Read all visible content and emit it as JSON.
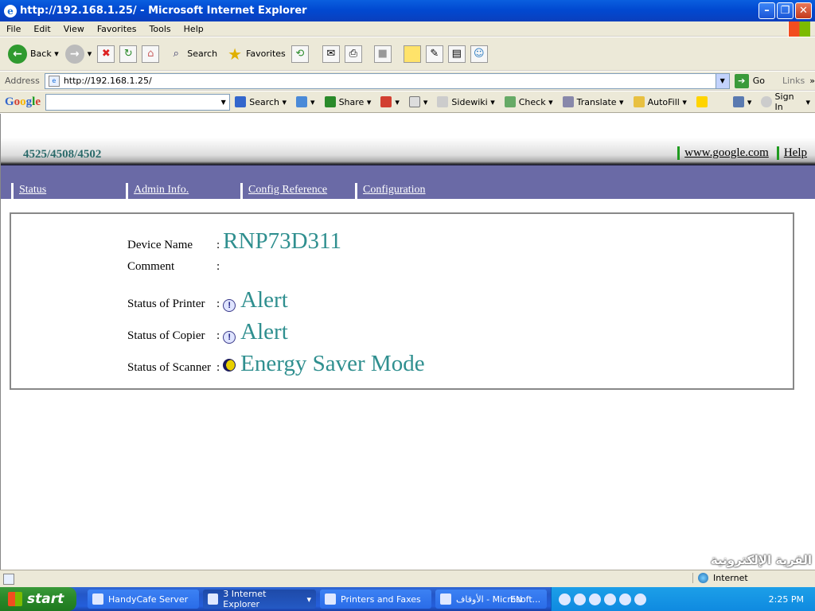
{
  "window": {
    "title": "http://192.168.1.25/ - Microsoft Internet Explorer",
    "icon": "ie-logo-icon"
  },
  "menu": [
    "File",
    "Edit",
    "View",
    "Favorites",
    "Tools",
    "Help"
  ],
  "toolbar": {
    "back": "Back",
    "search": "Search",
    "favorites": "Favorites"
  },
  "address": {
    "label": "Address",
    "url": "http://192.168.1.25/",
    "go": "Go",
    "links": "Links"
  },
  "google_toolbar": {
    "logo": [
      "G",
      "o",
      "o",
      "g",
      "l",
      "e"
    ],
    "search": "Search",
    "share": "Share",
    "sidewiki": "Sidewiki",
    "check": "Check",
    "translate": "Translate",
    "autofill": "AutoFill",
    "signin": "Sign In"
  },
  "page": {
    "model": "4525/4508/4502",
    "top_links": [
      "www.google.com",
      "Help"
    ],
    "nav": [
      "Status",
      "Admin Info.",
      "Config Reference",
      "Configuration"
    ],
    "fields": [
      {
        "label": "Device Name",
        "sep": ":",
        "value": "RNP73D311",
        "icon": ""
      },
      {
        "label": "Comment",
        "sep": ":",
        "value": "",
        "icon": ""
      },
      {
        "label": "Status of Printer",
        "sep": ":",
        "value": "Alert",
        "icon": "alert"
      },
      {
        "label": "Status of Copier",
        "sep": ":",
        "value": "Alert",
        "icon": "alert"
      },
      {
        "label": "Status of Scanner",
        "sep": ":",
        "value": "Energy Saver Mode",
        "icon": "saver"
      }
    ]
  },
  "statusbar": {
    "zone": "Internet"
  },
  "taskbar": {
    "start": "start",
    "tasks": [
      "HandyCafe Server",
      "3 Internet Explorer",
      "Printers and Faxes",
      "الأوقاف - Microsoft..."
    ],
    "lang": "EN",
    "time": "2:25 PM"
  },
  "watermark": "القرية الإلكترونية"
}
